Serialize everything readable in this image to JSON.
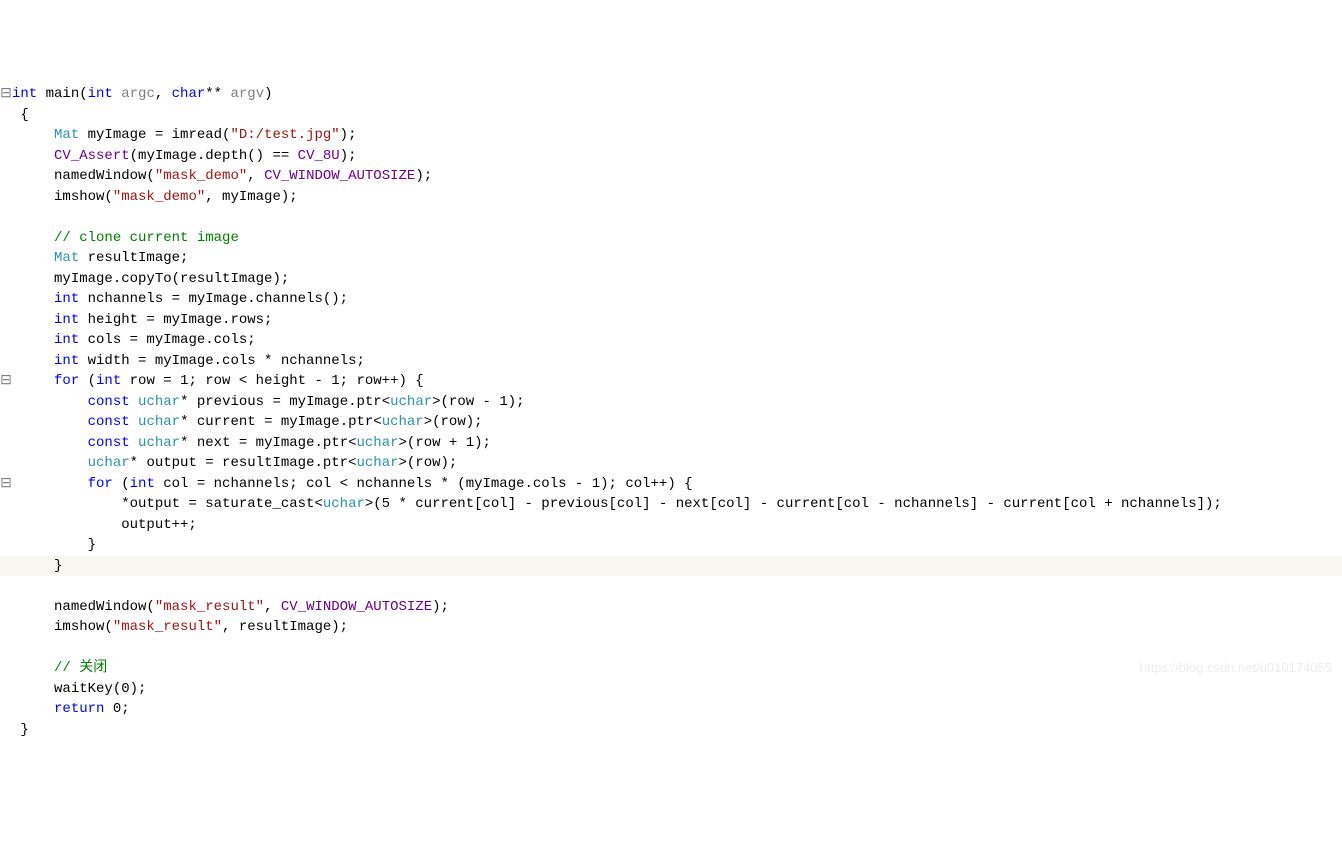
{
  "watermark": "https://blog.csdn.net/u010174055",
  "code": {
    "lines": [
      {
        "gutter": "⊟",
        "indent": 0,
        "tokens": [
          {
            "t": "int ",
            "c": "kw"
          },
          {
            "t": "main(",
            "c": ""
          },
          {
            "t": "int ",
            "c": "kw"
          },
          {
            "t": "argc",
            "c": "gray"
          },
          {
            "t": ", ",
            "c": ""
          },
          {
            "t": "char",
            "c": "kw"
          },
          {
            "t": "** ",
            "c": ""
          },
          {
            "t": "argv",
            "c": "gray"
          },
          {
            "t": ")",
            "c": ""
          }
        ]
      },
      {
        "gutter": " ",
        "indent": 1,
        "tokens": [
          {
            "t": "{",
            "c": ""
          }
        ]
      },
      {
        "gutter": " ",
        "indent": 5,
        "tokens": [
          {
            "t": "Mat ",
            "c": "type"
          },
          {
            "t": "myImage = imread(",
            "c": ""
          },
          {
            "t": "\"D:/test.jpg\"",
            "c": "str"
          },
          {
            "t": ");",
            "c": ""
          }
        ]
      },
      {
        "gutter": " ",
        "indent": 5,
        "tokens": [
          {
            "t": "CV_Assert",
            "c": "fn"
          },
          {
            "t": "(myImage.depth() == ",
            "c": ""
          },
          {
            "t": "CV_8U",
            "c": "fn"
          },
          {
            "t": ");",
            "c": ""
          }
        ]
      },
      {
        "gutter": " ",
        "indent": 5,
        "tokens": [
          {
            "t": "namedWindow(",
            "c": ""
          },
          {
            "t": "\"mask_demo\"",
            "c": "str"
          },
          {
            "t": ", ",
            "c": ""
          },
          {
            "t": "CV_WINDOW_AUTOSIZE",
            "c": "fn"
          },
          {
            "t": ");",
            "c": ""
          }
        ]
      },
      {
        "gutter": " ",
        "indent": 5,
        "tokens": [
          {
            "t": "imshow(",
            "c": ""
          },
          {
            "t": "\"mask_demo\"",
            "c": "str"
          },
          {
            "t": ", myImage);",
            "c": ""
          }
        ]
      },
      {
        "gutter": " ",
        "indent": 0,
        "tokens": [
          {
            "t": "",
            "c": ""
          }
        ]
      },
      {
        "gutter": " ",
        "indent": 5,
        "tokens": [
          {
            "t": "// clone current image",
            "c": "cmt"
          }
        ]
      },
      {
        "gutter": " ",
        "indent": 5,
        "tokens": [
          {
            "t": "Mat ",
            "c": "type"
          },
          {
            "t": "resultImage;",
            "c": ""
          }
        ]
      },
      {
        "gutter": " ",
        "indent": 5,
        "tokens": [
          {
            "t": "myImage.copyTo(resultImage);",
            "c": ""
          }
        ]
      },
      {
        "gutter": " ",
        "indent": 5,
        "tokens": [
          {
            "t": "int ",
            "c": "kw"
          },
          {
            "t": "nchannels = myImage.channels();",
            "c": ""
          }
        ]
      },
      {
        "gutter": " ",
        "indent": 5,
        "tokens": [
          {
            "t": "int ",
            "c": "kw"
          },
          {
            "t": "height = myImage.rows;",
            "c": ""
          }
        ]
      },
      {
        "gutter": " ",
        "indent": 5,
        "tokens": [
          {
            "t": "int ",
            "c": "kw"
          },
          {
            "t": "cols = myImage.cols;",
            "c": ""
          }
        ]
      },
      {
        "gutter": " ",
        "indent": 5,
        "tokens": [
          {
            "t": "int ",
            "c": "kw"
          },
          {
            "t": "width = myImage.cols * nchannels;",
            "c": ""
          }
        ]
      },
      {
        "gutter": "⊟",
        "indent": 5,
        "tokens": [
          {
            "t": "for ",
            "c": "kw"
          },
          {
            "t": "(",
            "c": ""
          },
          {
            "t": "int ",
            "c": "kw"
          },
          {
            "t": "row = 1; row < height - 1; row++) {",
            "c": ""
          }
        ]
      },
      {
        "gutter": " ",
        "indent": 9,
        "tokens": [
          {
            "t": "const ",
            "c": "kw"
          },
          {
            "t": "uchar",
            "c": "type"
          },
          {
            "t": "* previous = myImage.ptr<",
            "c": ""
          },
          {
            "t": "uchar",
            "c": "type"
          },
          {
            "t": ">(row - 1);",
            "c": ""
          }
        ]
      },
      {
        "gutter": " ",
        "indent": 9,
        "tokens": [
          {
            "t": "const ",
            "c": "kw"
          },
          {
            "t": "uchar",
            "c": "type"
          },
          {
            "t": "* current = myImage.ptr<",
            "c": ""
          },
          {
            "t": "uchar",
            "c": "type"
          },
          {
            "t": ">(row);",
            "c": ""
          }
        ]
      },
      {
        "gutter": " ",
        "indent": 9,
        "tokens": [
          {
            "t": "const ",
            "c": "kw"
          },
          {
            "t": "uchar",
            "c": "type"
          },
          {
            "t": "* next = myImage.ptr<",
            "c": ""
          },
          {
            "t": "uchar",
            "c": "type"
          },
          {
            "t": ">(row + 1);",
            "c": ""
          }
        ]
      },
      {
        "gutter": " ",
        "indent": 9,
        "tokens": [
          {
            "t": "uchar",
            "c": "type"
          },
          {
            "t": "* output = resultImage.ptr<",
            "c": ""
          },
          {
            "t": "uchar",
            "c": "type"
          },
          {
            "t": ">(row);",
            "c": ""
          }
        ]
      },
      {
        "gutter": "⊟",
        "indent": 9,
        "tokens": [
          {
            "t": "for ",
            "c": "kw"
          },
          {
            "t": "(",
            "c": ""
          },
          {
            "t": "int ",
            "c": "kw"
          },
          {
            "t": "col = nchannels; col < nchannels * (myImage.cols - 1); col++) {",
            "c": ""
          }
        ]
      },
      {
        "gutter": " ",
        "indent": 13,
        "tokens": [
          {
            "t": "*output = saturate_cast<",
            "c": ""
          },
          {
            "t": "uchar",
            "c": "type"
          },
          {
            "t": ">(5 * current[col] - previous[col] - next[col] - current[col - nchannels] - current[col + nchannels]);",
            "c": ""
          }
        ]
      },
      {
        "gutter": " ",
        "indent": 13,
        "tokens": [
          {
            "t": "output++;",
            "c": ""
          }
        ]
      },
      {
        "gutter": " ",
        "indent": 9,
        "tokens": [
          {
            "t": "}",
            "c": ""
          }
        ]
      },
      {
        "gutter": " ",
        "indent": 5,
        "hl": true,
        "tokens": [
          {
            "t": "}",
            "c": ""
          }
        ]
      },
      {
        "gutter": " ",
        "indent": 0,
        "tokens": [
          {
            "t": "",
            "c": ""
          }
        ]
      },
      {
        "gutter": " ",
        "indent": 5,
        "tokens": [
          {
            "t": "namedWindow(",
            "c": ""
          },
          {
            "t": "\"mask_result\"",
            "c": "str"
          },
          {
            "t": ", ",
            "c": ""
          },
          {
            "t": "CV_WINDOW_AUTOSIZE",
            "c": "fn"
          },
          {
            "t": ");",
            "c": ""
          }
        ]
      },
      {
        "gutter": " ",
        "indent": 5,
        "tokens": [
          {
            "t": "imshow(",
            "c": ""
          },
          {
            "t": "\"mask_result\"",
            "c": "str"
          },
          {
            "t": ", resultImage);",
            "c": ""
          }
        ]
      },
      {
        "gutter": " ",
        "indent": 0,
        "tokens": [
          {
            "t": "",
            "c": ""
          }
        ]
      },
      {
        "gutter": " ",
        "indent": 5,
        "tokens": [
          {
            "t": "// 关闭",
            "c": "cmt"
          }
        ]
      },
      {
        "gutter": " ",
        "indent": 5,
        "tokens": [
          {
            "t": "waitKey(0);",
            "c": ""
          }
        ]
      },
      {
        "gutter": " ",
        "indent": 5,
        "tokens": [
          {
            "t": "return ",
            "c": "kw"
          },
          {
            "t": "0;",
            "c": ""
          }
        ]
      },
      {
        "gutter": " ",
        "indent": 1,
        "tokens": [
          {
            "t": "}",
            "c": ""
          }
        ]
      }
    ]
  }
}
